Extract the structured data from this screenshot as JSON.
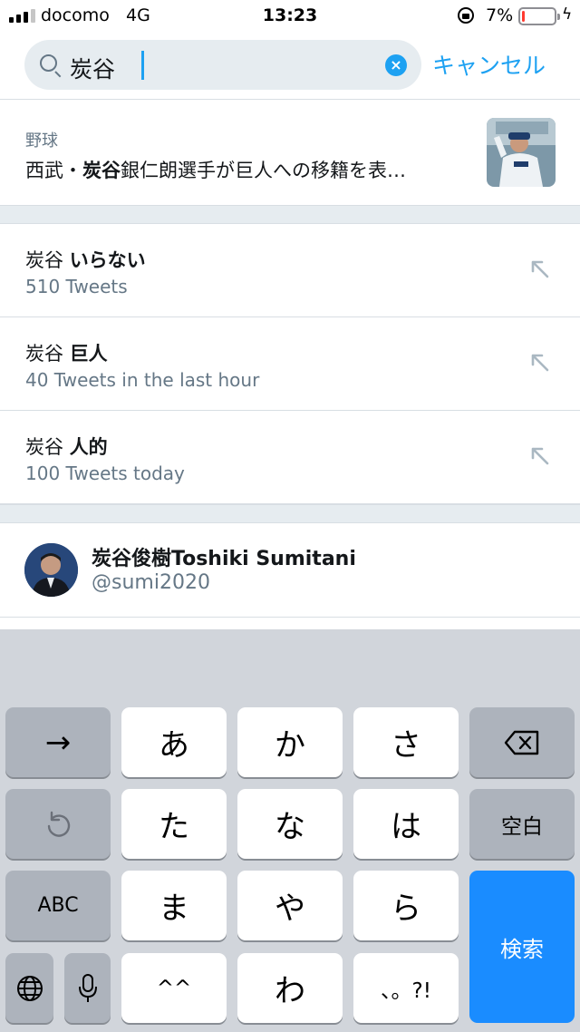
{
  "status_bar": {
    "carrier": "docomo",
    "network": "4G",
    "time": "13:23",
    "battery_percent": "7%",
    "battery_level": 0.07,
    "battery_color": "#ff3b30"
  },
  "search": {
    "query": "炭谷",
    "clear_icon": "clear-icon",
    "cancel_label": "キャンセル"
  },
  "news": {
    "category": "野球",
    "title_prefix": "西武・",
    "title_bold": "炭谷",
    "title_suffix": "銀仁朗選手が巨人への移籍を表…"
  },
  "suggestions": [
    {
      "prefix": "炭谷 ",
      "bold": "いらない",
      "meta": "510 Tweets"
    },
    {
      "prefix": "炭谷 ",
      "bold": "巨人",
      "meta": "40 Tweets in the last hour"
    },
    {
      "prefix": "炭谷 ",
      "bold": "人的",
      "meta": "100 Tweets today"
    }
  ],
  "account": {
    "name": "炭谷俊樹Toshiki Sumitani",
    "handle": "@sumi2020"
  },
  "keyboard": {
    "next_key": "→",
    "undo_icon": "undo-icon",
    "abc_key": "ABC",
    "globe_icon": "globe-icon",
    "mic_icon": "mic-icon",
    "delete_icon": "delete-icon",
    "space_key": "空白",
    "search_key": "検索",
    "kana": [
      "あ",
      "か",
      "さ",
      "た",
      "な",
      "は",
      "ま",
      "や",
      "ら",
      "^^",
      "わ",
      "、。?!"
    ]
  },
  "colors": {
    "accent": "#1da1f2",
    "secondary_text": "#657786",
    "search_key": "#1a8cff"
  }
}
